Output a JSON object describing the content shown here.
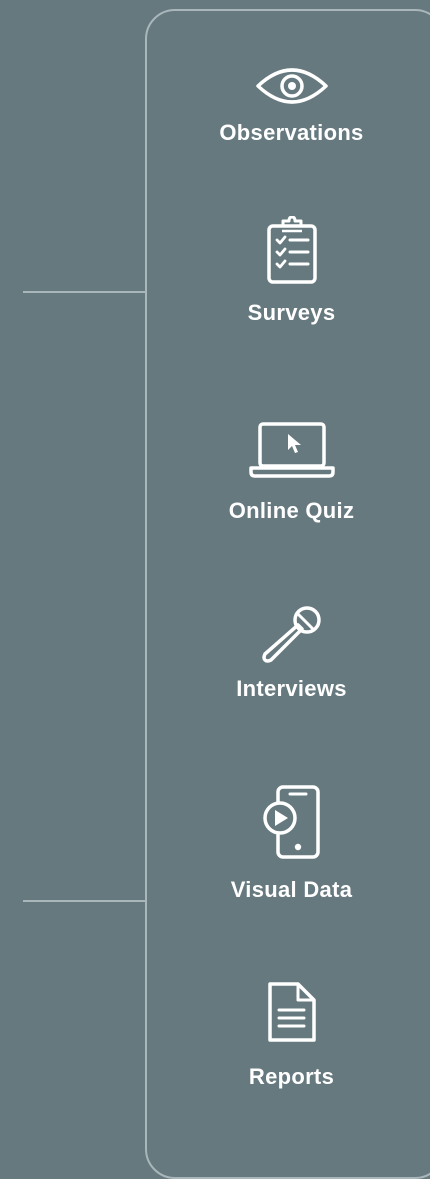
{
  "methods": [
    {
      "label": "Observations",
      "icon": "eye-icon"
    },
    {
      "label": "Surveys",
      "icon": "clipboard-checklist-icon"
    },
    {
      "label": "Online Quiz",
      "icon": "laptop-cursor-icon"
    },
    {
      "label": "Interviews",
      "icon": "microphone-icon"
    },
    {
      "label": "Visual Data",
      "icon": "phone-play-icon"
    },
    {
      "label": "Reports",
      "icon": "document-icon"
    }
  ],
  "colors": {
    "background": "#66797f",
    "line": "#a9b6ba",
    "text": "#ffffff"
  }
}
